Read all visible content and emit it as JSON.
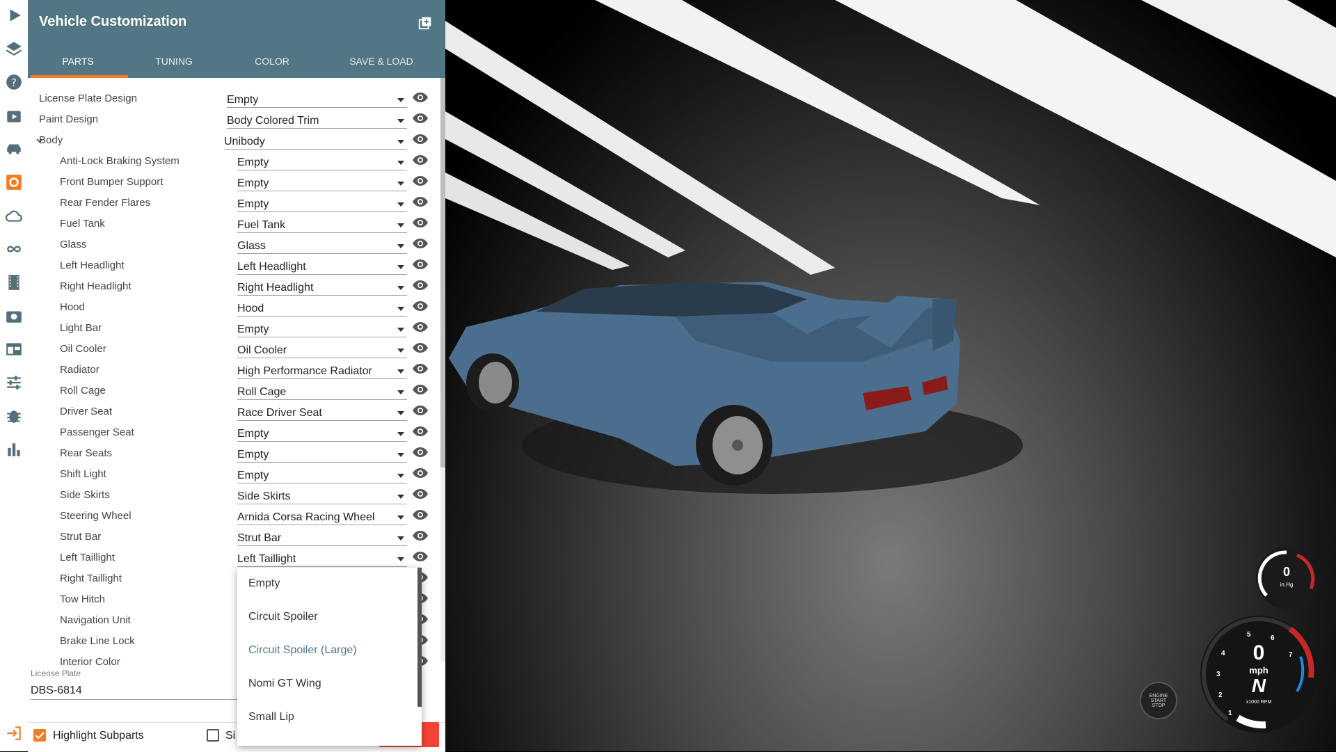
{
  "panel": {
    "title": "Vehicle Customization",
    "tabs": [
      "PARTS",
      "TUNING",
      "COLOR",
      "SAVE & LOAD"
    ],
    "active_tab": "PARTS"
  },
  "parts": [
    {
      "label": "License Plate Design",
      "value": "Empty",
      "level": 0
    },
    {
      "label": "Paint Design",
      "value": "Body Colored Trim",
      "level": 0
    },
    {
      "label": "Body",
      "value": "Unibody",
      "level": 0,
      "expanded": true
    },
    {
      "label": "Anti-Lock Braking System",
      "value": "Empty",
      "level": 1
    },
    {
      "label": "Front Bumper Support",
      "value": "Empty",
      "level": 1
    },
    {
      "label": "Rear Fender Flares",
      "value": "Empty",
      "level": 1
    },
    {
      "label": "Fuel Tank",
      "value": "Fuel Tank",
      "level": 1
    },
    {
      "label": "Glass",
      "value": "Glass",
      "level": 1
    },
    {
      "label": "Left Headlight",
      "value": "Left Headlight",
      "level": 1
    },
    {
      "label": "Right Headlight",
      "value": "Right Headlight",
      "level": 1
    },
    {
      "label": "Hood",
      "value": "Hood",
      "level": 1
    },
    {
      "label": "Light Bar",
      "value": "Empty",
      "level": 1
    },
    {
      "label": "Oil Cooler",
      "value": "Oil Cooler",
      "level": 1
    },
    {
      "label": "Radiator",
      "value": "High Performance Radiator",
      "level": 1
    },
    {
      "label": "Roll Cage",
      "value": "Roll Cage",
      "level": 1
    },
    {
      "label": "Driver Seat",
      "value": "Race Driver Seat",
      "level": 1
    },
    {
      "label": "Passenger Seat",
      "value": "Empty",
      "level": 1
    },
    {
      "label": "Rear Seats",
      "value": "Empty",
      "level": 1
    },
    {
      "label": "Shift Light",
      "value": "Empty",
      "level": 1
    },
    {
      "label": "Side Skirts",
      "value": "Side Skirts",
      "level": 1
    },
    {
      "label": "Steering Wheel",
      "value": "Arnida Corsa Racing Wheel",
      "level": 1
    },
    {
      "label": "Strut Bar",
      "value": "Strut Bar",
      "level": 1
    },
    {
      "label": "Left Taillight",
      "value": "Left Taillight",
      "level": 1
    },
    {
      "label": "Right Taillight",
      "value": "",
      "level": 1
    },
    {
      "label": "Tow Hitch",
      "value": "",
      "level": 1
    },
    {
      "label": "Navigation Unit",
      "value": "",
      "level": 1
    },
    {
      "label": "Brake Line Lock",
      "value": "",
      "level": 1
    },
    {
      "label": "Interior Color",
      "value": "",
      "level": 1
    }
  ],
  "dropdown": {
    "options": [
      "Empty",
      "Circuit Spoiler",
      "Circuit Spoiler (Large)",
      "Nomi GT Wing",
      "Small Lip"
    ],
    "highlighted": "Circuit Spoiler (Large)"
  },
  "license_plate": {
    "label": "License Plate",
    "value": "DBS-6814"
  },
  "bottom": {
    "highlight_label": "Highlight Subparts",
    "highlight_checked": true,
    "simple_label": "Si",
    "simple_checked": false
  },
  "hud": {
    "start_stop": [
      "ENGINE",
      "START",
      "STOP"
    ],
    "boost_value": "0",
    "boost_unit": "in.Hg",
    "speed": "0",
    "speed_unit": "mph",
    "gear": "N",
    "rpm_unit": "x1000 RPM",
    "rpm_ticks": [
      "1",
      "2",
      "3",
      "4",
      "5",
      "6",
      "7"
    ]
  },
  "colors": {
    "header": "#527683",
    "accent": "#f27d22",
    "car": "#4c6e8e"
  },
  "toolbar_icons": [
    "play-icon",
    "layers-icon",
    "help-icon",
    "scenario-icon",
    "vehicle-icon",
    "vehicle-config-icon",
    "cloud-icon",
    "loop-icon",
    "film-icon",
    "camera-icon",
    "window-icon",
    "sliders-icon",
    "bug-icon",
    "stats-icon",
    "exit-icon"
  ]
}
